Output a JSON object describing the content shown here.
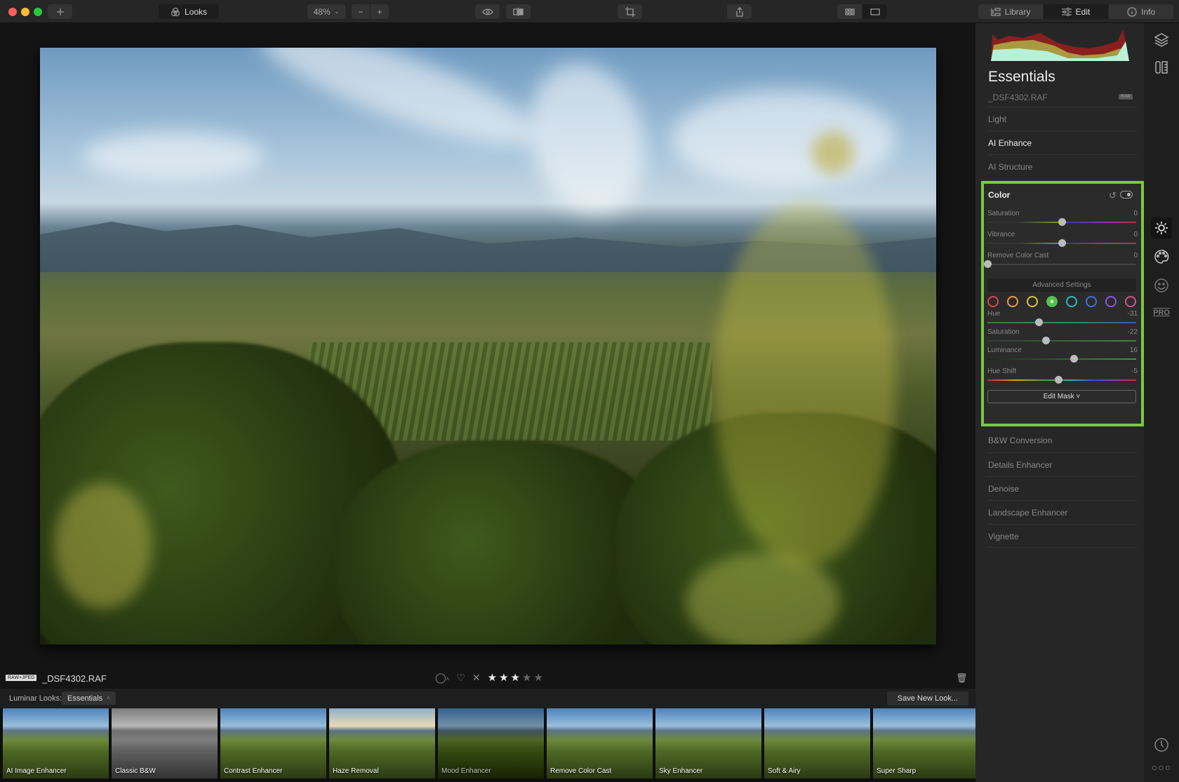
{
  "titlebar": {
    "traffic_lights": {
      "close": "#fe5f57",
      "minimize": "#febc2e",
      "zoom": "#28c840"
    },
    "add_icon": "plus-icon",
    "looks_label": "Looks",
    "zoom_value": "48%",
    "zoom_out": "−",
    "zoom_in": "+",
    "view_tabs": [
      {
        "label": "Library",
        "icon": "library-icon",
        "active": false
      },
      {
        "label": "Edit",
        "icon": "sliders-icon",
        "active": true
      },
      {
        "label": "Info",
        "icon": "info-icon",
        "active": false
      }
    ]
  },
  "image": {
    "badge": "RAW+JPEG",
    "filename": "_DSF4302.RAF",
    "rating": 3,
    "max_rating": 5
  },
  "looks": {
    "label": "Luminar Looks:",
    "selected": "Essentials",
    "save_label": "Save New Look...",
    "items": [
      {
        "name": "AI Image Enhancer",
        "style": ""
      },
      {
        "name": "Classic B&W",
        "style": "bw"
      },
      {
        "name": "Contrast Enhancer",
        "style": ""
      },
      {
        "name": "Haze Removal",
        "style": "warm"
      },
      {
        "name": "Mood Enhancer",
        "style": "dark"
      },
      {
        "name": "Remove Color Cast",
        "style": ""
      },
      {
        "name": "Sky Enhancer",
        "style": ""
      },
      {
        "name": "Soft & Airy",
        "style": ""
      },
      {
        "name": "Super Sharp",
        "style": ""
      }
    ]
  },
  "panel": {
    "title": "Essentials",
    "filename": "_DSF4302.RAF",
    "raw_tag": "RAW",
    "sections_top": [
      "Light",
      "AI Enhance",
      "AI Structure"
    ],
    "active_section": "AI Enhance",
    "color": {
      "title": "Color",
      "highlight": "#7ac943",
      "sliders": [
        {
          "label": "Saturation",
          "value": "0",
          "pos": 0.5
        },
        {
          "label": "Vibrance",
          "value": "0",
          "pos": 0.5
        },
        {
          "label": "Remove Color Cast",
          "value": "0",
          "pos": 0.0
        }
      ],
      "advanced_label": "Advanced Settings",
      "swatches": [
        "#e0463d",
        "#ef9a3c",
        "#d9c632",
        "#52c24a",
        "#29b9c4",
        "#3f6fe0",
        "#8b55e8",
        "#d6508e"
      ],
      "selected_swatch": 3,
      "hsl_sliders": [
        {
          "label": "Hue",
          "value": "-31",
          "pos": 0.345
        },
        {
          "label": "Saturation",
          "value": "-22",
          "pos": 0.39
        },
        {
          "label": "Luminance",
          "value": "16",
          "pos": 0.58
        },
        {
          "label": "Hue Shift",
          "value": "-5",
          "pos": 0.475
        }
      ],
      "edit_mask_label": "Edit Mask ˅"
    },
    "sections_bottom": [
      "B&W Conversion",
      "Details Enhancer",
      "Denoise",
      "Landscape Enhancer",
      "Vignette"
    ]
  },
  "side_icons": [
    "layers-icon",
    "canvas-icon",
    "essentials-sun-icon",
    "creative-palette-icon",
    "portrait-face-icon",
    "pro-icon",
    "history-clock-icon",
    "more-icon"
  ]
}
